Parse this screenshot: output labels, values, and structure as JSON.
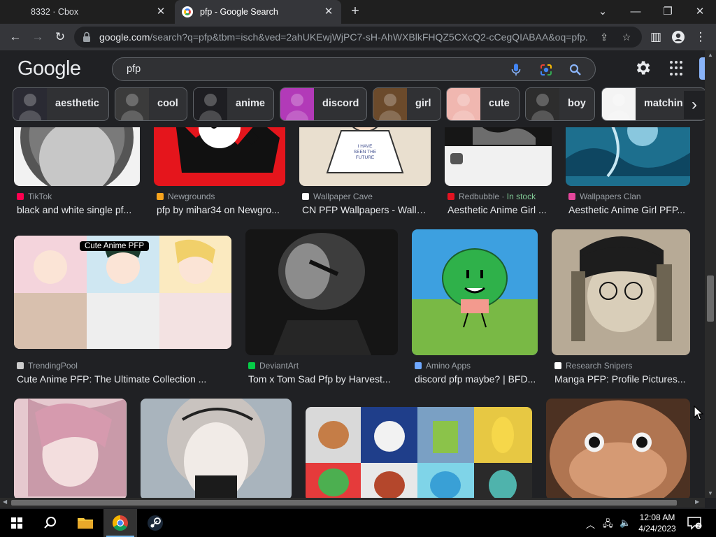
{
  "tabs": [
    {
      "title": "8332 · Cbox",
      "active": false
    },
    {
      "title": "pfp - Google Search",
      "active": true
    }
  ],
  "window_controls": {
    "menu": "⌄",
    "minimize": "—",
    "restore": "❐",
    "close": "✕"
  },
  "address_bar": {
    "host": "google.com",
    "path": "/search?q=pfp&tbm=isch&ved=2ahUKEwjWjPC7-sH-AhWXBlkFHQZ5CXcQ2-cCegQIABAA&oq=pfp..."
  },
  "google": {
    "logo": "Google",
    "query": "pfp"
  },
  "chips": [
    {
      "label": "aesthetic",
      "thumb": "#2a2a33"
    },
    {
      "label": "cool",
      "thumb": "#3b3b3b"
    },
    {
      "label": "anime",
      "thumb": "#1e1e22"
    },
    {
      "label": "discord",
      "thumb": "#b23ab8"
    },
    {
      "label": "girl",
      "thumb": "#6b4a2b"
    },
    {
      "label": "cute",
      "thumb": "#f0b7b0"
    },
    {
      "label": "boy",
      "thumb": "#2d2d2d"
    },
    {
      "label": "matchin",
      "thumb": "#f4f4f4"
    }
  ],
  "row1": [
    {
      "source": "TikTok",
      "title": "black and white single pf...",
      "fav": "#ff0050",
      "img": {
        "kind": "grey-avatar",
        "bg": "#f2f2f2",
        "fg": "#c7c7c7"
      }
    },
    {
      "source": "Newgrounds",
      "title": "pfp by mihar34 on Newgro...",
      "fav": "#f7a41d",
      "img": {
        "kind": "red-character",
        "bg": "#e5151c",
        "fg": "#111111"
      }
    },
    {
      "source": "Wallpaper Cave",
      "title": "CN PFP Wallpapers - Wallp...",
      "fav": "#ffffff",
      "img": {
        "kind": "figure-white-shirt",
        "bg": "#e9dfcf",
        "fg": "#ffffff",
        "shirt_text": "I HAVE SEEN THE FUTURE"
      }
    },
    {
      "source": "Redbubble",
      "stock": "In stock",
      "title": "Aesthetic Anime Girl ...",
      "fav": "#e41321",
      "img": {
        "kind": "dark-sticker",
        "bg": "#161616",
        "fg": "#6d6d6d"
      }
    },
    {
      "source": "Wallpapers Clan",
      "title": "Aesthetic Anime Girl PFP...",
      "fav": "#e5469b",
      "img": {
        "kind": "blue-water-girl",
        "bg": "#1d6f8e",
        "fg": "#89c7de"
      }
    }
  ],
  "row2": [
    {
      "source": "TrendingPool",
      "title": "Cute Anime PFP: The Ultimate Collection ...",
      "fav": "#cccccc",
      "overlay": "Cute Anime PFP",
      "img": {
        "kind": "anime-collage",
        "bg": "#f2e6e0"
      }
    },
    {
      "source": "DeviantArt",
      "title": "Tom x Tom Sad Pfp by Harvest...",
      "fav": "#05cc47",
      "img": {
        "kind": "tom-cat-dark",
        "bg": "#151515",
        "fg": "#8c8c8c"
      }
    },
    {
      "source": "Amino Apps",
      "title": "discord pfp maybe? | BFD...",
      "fav": "#6fa8ff",
      "img": {
        "kind": "bfdi-tree",
        "bg": "#3da0e0",
        "fg": "#2fb14a"
      }
    },
    {
      "source": "Research Snipers",
      "title": "Manga PFP: Profile Pictures...",
      "fav": "#ffffff",
      "img": {
        "kind": "manga-boy",
        "bg": "#b7aa96",
        "fg": "#1d1d1d"
      }
    }
  ],
  "row3": [
    {
      "img": {
        "kind": "pink-anime",
        "bg": "#e6c9cf"
      }
    },
    {
      "img": {
        "kind": "grey-anime",
        "bg": "#a9b4bd"
      }
    },
    {
      "img": {
        "kind": "pepe-collage",
        "bg": "#3e3e3e"
      }
    },
    {
      "img": {
        "kind": "dog-face",
        "bg": "#4c3122"
      }
    }
  ],
  "taskbar": {
    "time": "12:08 AM",
    "date": "4/24/2023",
    "apps": [
      "start",
      "search",
      "file-explorer",
      "chrome",
      "steam"
    ]
  }
}
